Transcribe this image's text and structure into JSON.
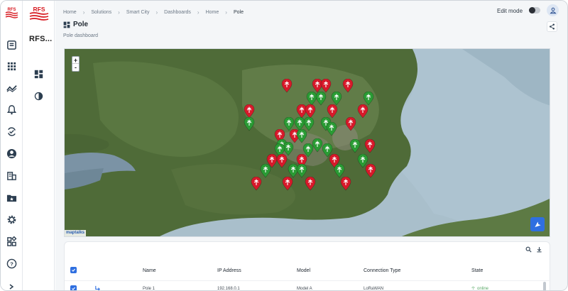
{
  "brand": {
    "name": "RFS..."
  },
  "breadcrumb": [
    "Home",
    "Solutions",
    "Smart City",
    "Dashboards",
    "Home",
    "Pole"
  ],
  "header": {
    "edit_mode_label": "Edit mode",
    "edit_mode_on": false
  },
  "page": {
    "title": "Pole",
    "subtitle": "Pole dashboard"
  },
  "map": {
    "zoom_in": "+",
    "zoom_out": "-",
    "attribution": "maptalks",
    "pins": [
      {
        "status": "offline"
      },
      {
        "status": "offline"
      },
      {
        "status": "offline"
      },
      {
        "status": "offline"
      },
      {
        "status": "online"
      },
      {
        "status": "online"
      },
      {
        "status": "online"
      },
      {
        "status": "online"
      },
      {
        "status": "offline"
      },
      {
        "status": "offline"
      },
      {
        "status": "offline"
      },
      {
        "status": "offline"
      },
      {
        "status": "offline"
      },
      {
        "status": "online"
      },
      {
        "status": "online"
      },
      {
        "status": "online"
      },
      {
        "status": "online"
      },
      {
        "status": "online"
      },
      {
        "status": "online"
      },
      {
        "status": "offline"
      },
      {
        "status": "offline"
      },
      {
        "status": "offline"
      },
      {
        "status": "online"
      },
      {
        "status": "online"
      },
      {
        "status": "online"
      },
      {
        "status": "online"
      },
      {
        "status": "online"
      },
      {
        "status": "online"
      },
      {
        "status": "online"
      },
      {
        "status": "online"
      },
      {
        "status": "offline"
      },
      {
        "status": "offline"
      },
      {
        "status": "offline"
      },
      {
        "status": "offline"
      },
      {
        "status": "offline"
      },
      {
        "status": "online"
      },
      {
        "status": "online"
      },
      {
        "status": "online"
      },
      {
        "status": "online"
      },
      {
        "status": "online"
      },
      {
        "status": "offline"
      },
      {
        "status": "offline"
      },
      {
        "status": "offline"
      },
      {
        "status": "offline"
      },
      {
        "status": "offline"
      }
    ]
  },
  "table": {
    "columns": [
      "Name",
      "IP Address",
      "Model",
      "Connection Type",
      "State"
    ],
    "rows": [
      {
        "name": "Pole 1",
        "ip": "192.168.0.1",
        "model": "Model A",
        "connection": "LoRaWAN",
        "state": "online"
      }
    ]
  },
  "colors": {
    "accent": "#2f6fe0",
    "offline_pin": "#d7192a",
    "online_pin": "#2a9b34",
    "online_text": "#5aa867"
  }
}
